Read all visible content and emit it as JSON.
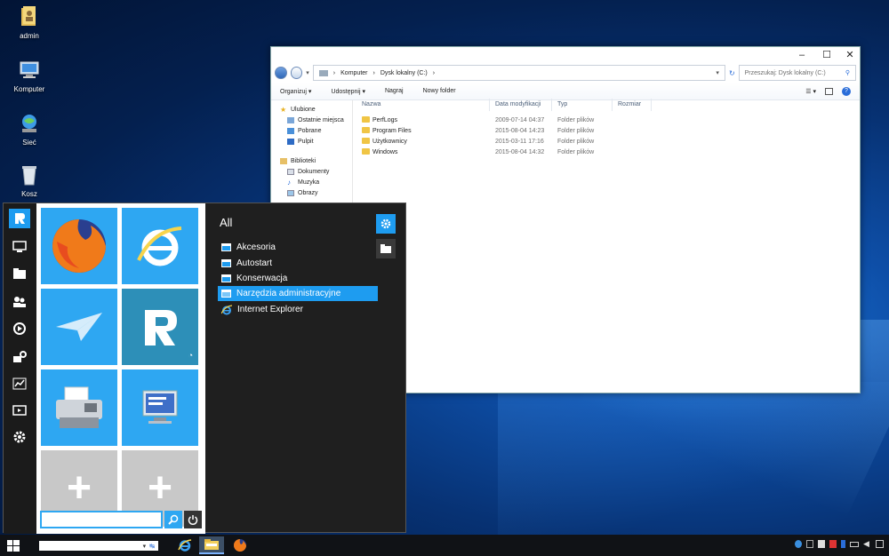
{
  "desktop": {
    "icons": [
      {
        "label": "admin",
        "icon": "user-folder-icon"
      },
      {
        "label": "Komputer",
        "icon": "computer-icon"
      },
      {
        "label": "Sieć",
        "icon": "network-icon"
      },
      {
        "label": "Kosz",
        "icon": "recycle-bin-icon"
      }
    ]
  },
  "explorer": {
    "window_buttons": {
      "minimize": "–",
      "maximize": "☐",
      "close": "✕"
    },
    "breadcrumb": [
      "Komputer",
      "Dysk lokalny (C:)"
    ],
    "search_placeholder": "Przeszukaj: Dysk lokalny (C:)",
    "toolbar": {
      "organize": "Organizuj",
      "share": "Udostępnij",
      "burn": "Nagraj",
      "new_folder": "Nowy folder"
    },
    "nav": {
      "favorites_title": "Ulubione",
      "favorites": [
        "Ostatnie miejsca",
        "Pobrane",
        "Pulpit"
      ],
      "libraries_title": "Biblioteki",
      "libraries": [
        "Dokumenty",
        "Muzyka",
        "Obrazy"
      ]
    },
    "columns": {
      "name": "Nazwa",
      "modified": "Data modyfikacji",
      "type": "Typ",
      "size": "Rozmiar"
    },
    "files": [
      {
        "name": "PerfLogs",
        "modified": "2009-07-14 04:37",
        "type": "Folder plików"
      },
      {
        "name": "Program Files",
        "modified": "2015-08-04 14:23",
        "type": "Folder plików"
      },
      {
        "name": "Użytkownicy",
        "modified": "2015-03-11 17:16",
        "type": "Folder plików"
      },
      {
        "name": "Windows",
        "modified": "2015-08-04 14:32",
        "type": "Folder plików"
      }
    ]
  },
  "start_menu": {
    "apps_title": "All",
    "apps": [
      {
        "label": "Akcesoria",
        "icon": "folder-icon",
        "selected": false
      },
      {
        "label": "Autostart",
        "icon": "folder-icon",
        "selected": false
      },
      {
        "label": "Konserwacja",
        "icon": "folder-icon",
        "selected": false
      },
      {
        "label": "Narzędzia administracyjne",
        "icon": "folder-icon",
        "selected": true
      },
      {
        "label": "Internet Explorer",
        "icon": "internet-explorer-icon",
        "selected": false
      }
    ],
    "tiles": [
      "firefox-icon",
      "internet-explorer-icon",
      "paper-plane-icon",
      "start-menu-app-icon",
      "fax-icon",
      "control-panel-icon",
      "add-tile-icon",
      "add-tile-icon"
    ],
    "rail": [
      "start-menu-app-icon",
      "computer-icon",
      "folder-icon",
      "users-icon",
      "media-icon",
      "tools-icon",
      "performance-icon",
      "display-icon",
      "gear-icon"
    ],
    "search_value": "",
    "accent_color": "#1e9cf0"
  },
  "taskbar": {
    "search_value": "",
    "pinned": [
      "internet-explorer-icon",
      "file-explorer-icon",
      "firefox-icon"
    ]
  }
}
